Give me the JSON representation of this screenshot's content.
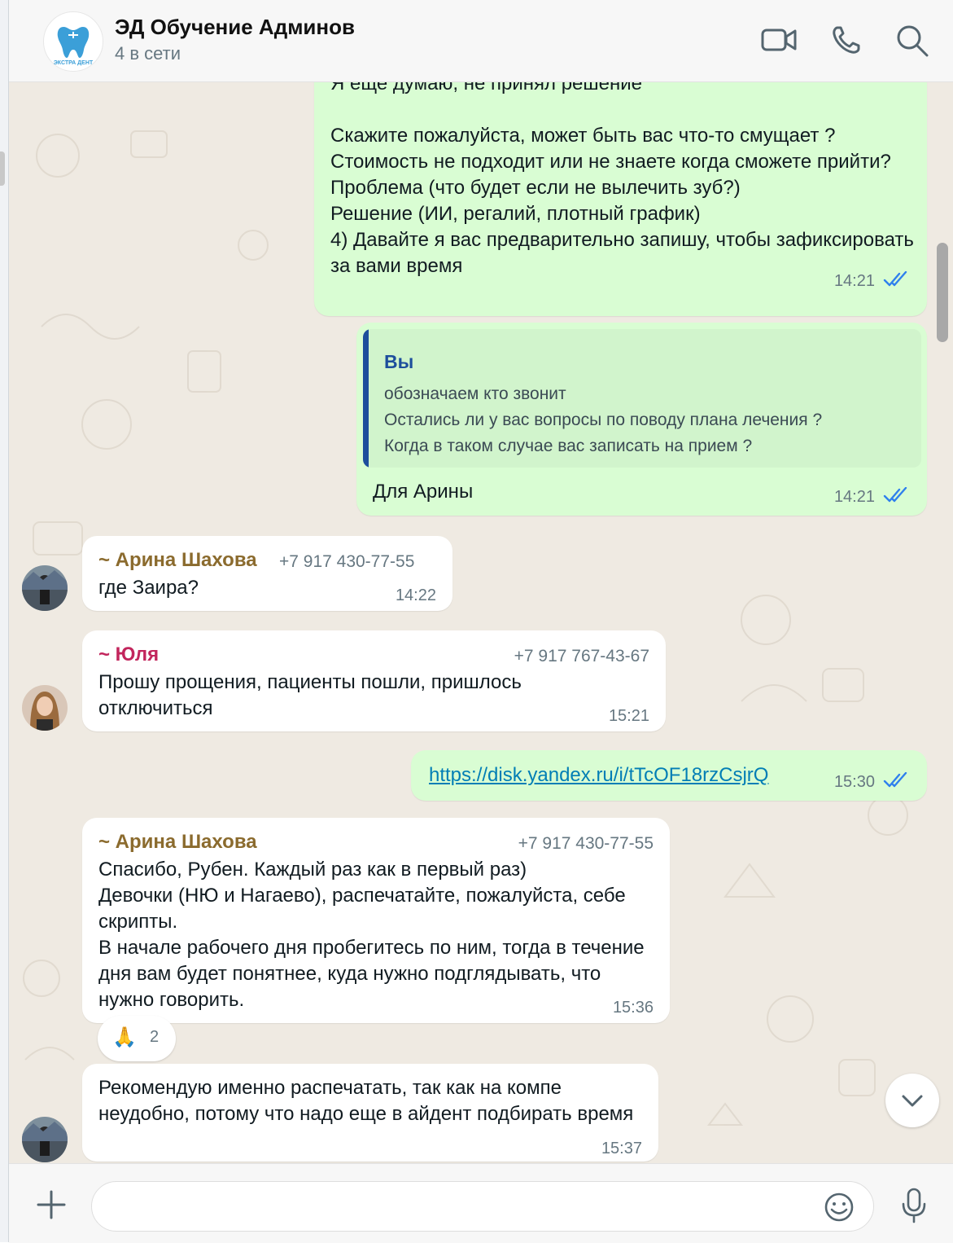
{
  "header": {
    "title": "ЭД Обучение Админов",
    "subtitle": "4 в сети",
    "logo_text": "ЭКСТРА ДЕНТ",
    "icons": [
      "video-call-icon",
      "phone-icon",
      "search-icon"
    ]
  },
  "messages": [
    {
      "direction": "out",
      "partial_first_line": "Я еще думаю, не принял решение",
      "text": "Скажите пожалуйста, может быть вас что-то смущает ?\nСтоимость не подходит или не знаете когда сможете прийти?\nПроблема (что будет если не вылечить зуб?)\nРешение (ИИ, регалий, плотный график)\n4)   Давайте я вас предварительно запишу, чтобы зафиксировать за вами время",
      "time": "14:21",
      "status": "read"
    },
    {
      "direction": "out",
      "quote": {
        "author": "Вы",
        "text": "обозначаем кто звонит\nОстались ли у вас вопросы по поводу плана лечения ?\nКогда в таком случае вас записать на прием ?"
      },
      "text": "Для Арины",
      "time": "14:21",
      "status": "read"
    },
    {
      "direction": "in",
      "sender": "~ Арина Шахова",
      "phone": "+7 917 430-77-55",
      "text": "где Заира?",
      "time": "14:22"
    },
    {
      "direction": "in",
      "sender": "~ Юля",
      "phone": "+7 917 767-43-67",
      "text": "Прошу прощения, пациенты пошли, пришлось отключиться",
      "time": "15:21"
    },
    {
      "direction": "out",
      "link": "https://disk.yandex.ru/i/tTcOF18rzCsjrQ",
      "time": "15:30",
      "status": "read"
    },
    {
      "direction": "in",
      "sender": "~ Арина Шахова",
      "phone": "+7 917 430-77-55",
      "text": "Спасибо, Рубен. Каждый раз как в первый раз)\nДевочки (НЮ и Нагаево), распечатайте, пожалуйста, себе скрипты.\nВ начале рабочего дня пробегитесь по ним, тогда в течение дня вам будет понятнее, куда нужно подглядывать, что нужно говорить.",
      "time": "15:36",
      "reaction": {
        "emoji": "🙏",
        "count": "2"
      }
    },
    {
      "direction": "in",
      "text": "Рекомендую именно распечатать, так как на компе неудобно, потому что надо еще в айдент подбирать время",
      "time": "15:37"
    }
  ],
  "composer": {
    "placeholder": "",
    "icons": [
      "plus-icon",
      "emoji-icon",
      "microphone-icon"
    ]
  },
  "colors": {
    "chat_bg": "#efeae2",
    "outgoing_bubble": "#d9fdd3",
    "incoming_bubble": "#ffffff",
    "read_ticks": "#2f80ed",
    "sender_arina": "#8b6b2e",
    "sender_yulia": "#c2255c",
    "quote_bar": "#1d4e9c"
  }
}
